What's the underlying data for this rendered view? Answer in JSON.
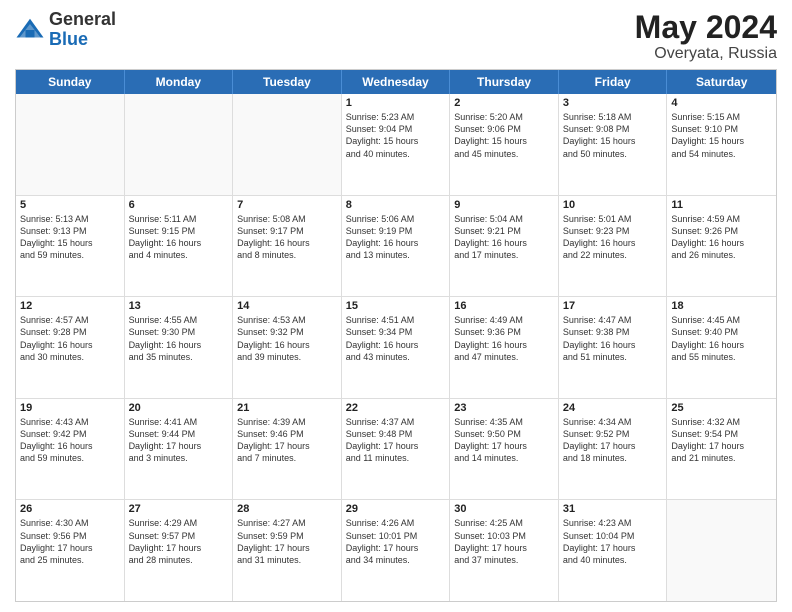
{
  "header": {
    "logo_general": "General",
    "logo_blue": "Blue",
    "title": "May 2024",
    "location": "Overyata, Russia"
  },
  "weekdays": [
    "Sunday",
    "Monday",
    "Tuesday",
    "Wednesday",
    "Thursday",
    "Friday",
    "Saturday"
  ],
  "rows": [
    [
      {
        "day": "",
        "info": ""
      },
      {
        "day": "",
        "info": ""
      },
      {
        "day": "",
        "info": ""
      },
      {
        "day": "1",
        "info": "Sunrise: 5:23 AM\nSunset: 9:04 PM\nDaylight: 15 hours\nand 40 minutes."
      },
      {
        "day": "2",
        "info": "Sunrise: 5:20 AM\nSunset: 9:06 PM\nDaylight: 15 hours\nand 45 minutes."
      },
      {
        "day": "3",
        "info": "Sunrise: 5:18 AM\nSunset: 9:08 PM\nDaylight: 15 hours\nand 50 minutes."
      },
      {
        "day": "4",
        "info": "Sunrise: 5:15 AM\nSunset: 9:10 PM\nDaylight: 15 hours\nand 54 minutes."
      }
    ],
    [
      {
        "day": "5",
        "info": "Sunrise: 5:13 AM\nSunset: 9:13 PM\nDaylight: 15 hours\nand 59 minutes."
      },
      {
        "day": "6",
        "info": "Sunrise: 5:11 AM\nSunset: 9:15 PM\nDaylight: 16 hours\nand 4 minutes."
      },
      {
        "day": "7",
        "info": "Sunrise: 5:08 AM\nSunset: 9:17 PM\nDaylight: 16 hours\nand 8 minutes."
      },
      {
        "day": "8",
        "info": "Sunrise: 5:06 AM\nSunset: 9:19 PM\nDaylight: 16 hours\nand 13 minutes."
      },
      {
        "day": "9",
        "info": "Sunrise: 5:04 AM\nSunset: 9:21 PM\nDaylight: 16 hours\nand 17 minutes."
      },
      {
        "day": "10",
        "info": "Sunrise: 5:01 AM\nSunset: 9:23 PM\nDaylight: 16 hours\nand 22 minutes."
      },
      {
        "day": "11",
        "info": "Sunrise: 4:59 AM\nSunset: 9:26 PM\nDaylight: 16 hours\nand 26 minutes."
      }
    ],
    [
      {
        "day": "12",
        "info": "Sunrise: 4:57 AM\nSunset: 9:28 PM\nDaylight: 16 hours\nand 30 minutes."
      },
      {
        "day": "13",
        "info": "Sunrise: 4:55 AM\nSunset: 9:30 PM\nDaylight: 16 hours\nand 35 minutes."
      },
      {
        "day": "14",
        "info": "Sunrise: 4:53 AM\nSunset: 9:32 PM\nDaylight: 16 hours\nand 39 minutes."
      },
      {
        "day": "15",
        "info": "Sunrise: 4:51 AM\nSunset: 9:34 PM\nDaylight: 16 hours\nand 43 minutes."
      },
      {
        "day": "16",
        "info": "Sunrise: 4:49 AM\nSunset: 9:36 PM\nDaylight: 16 hours\nand 47 minutes."
      },
      {
        "day": "17",
        "info": "Sunrise: 4:47 AM\nSunset: 9:38 PM\nDaylight: 16 hours\nand 51 minutes."
      },
      {
        "day": "18",
        "info": "Sunrise: 4:45 AM\nSunset: 9:40 PM\nDaylight: 16 hours\nand 55 minutes."
      }
    ],
    [
      {
        "day": "19",
        "info": "Sunrise: 4:43 AM\nSunset: 9:42 PM\nDaylight: 16 hours\nand 59 minutes."
      },
      {
        "day": "20",
        "info": "Sunrise: 4:41 AM\nSunset: 9:44 PM\nDaylight: 17 hours\nand 3 minutes."
      },
      {
        "day": "21",
        "info": "Sunrise: 4:39 AM\nSunset: 9:46 PM\nDaylight: 17 hours\nand 7 minutes."
      },
      {
        "day": "22",
        "info": "Sunrise: 4:37 AM\nSunset: 9:48 PM\nDaylight: 17 hours\nand 11 minutes."
      },
      {
        "day": "23",
        "info": "Sunrise: 4:35 AM\nSunset: 9:50 PM\nDaylight: 17 hours\nand 14 minutes."
      },
      {
        "day": "24",
        "info": "Sunrise: 4:34 AM\nSunset: 9:52 PM\nDaylight: 17 hours\nand 18 minutes."
      },
      {
        "day": "25",
        "info": "Sunrise: 4:32 AM\nSunset: 9:54 PM\nDaylight: 17 hours\nand 21 minutes."
      }
    ],
    [
      {
        "day": "26",
        "info": "Sunrise: 4:30 AM\nSunset: 9:56 PM\nDaylight: 17 hours\nand 25 minutes."
      },
      {
        "day": "27",
        "info": "Sunrise: 4:29 AM\nSunset: 9:57 PM\nDaylight: 17 hours\nand 28 minutes."
      },
      {
        "day": "28",
        "info": "Sunrise: 4:27 AM\nSunset: 9:59 PM\nDaylight: 17 hours\nand 31 minutes."
      },
      {
        "day": "29",
        "info": "Sunrise: 4:26 AM\nSunset: 10:01 PM\nDaylight: 17 hours\nand 34 minutes."
      },
      {
        "day": "30",
        "info": "Sunrise: 4:25 AM\nSunset: 10:03 PM\nDaylight: 17 hours\nand 37 minutes."
      },
      {
        "day": "31",
        "info": "Sunrise: 4:23 AM\nSunset: 10:04 PM\nDaylight: 17 hours\nand 40 minutes."
      },
      {
        "day": "",
        "info": ""
      }
    ]
  ]
}
